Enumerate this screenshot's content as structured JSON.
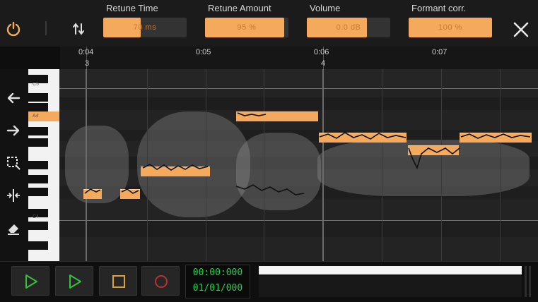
{
  "toolbar": {
    "power_icon": "power-icon",
    "sort_icon": "up-down-arrows-icon",
    "close_icon": "close-icon",
    "params": [
      {
        "label": "Retune Time",
        "value": "70 ms",
        "fill": 0.45
      },
      {
        "label": "Retune Amount",
        "value": "95 %",
        "fill": 0.95
      },
      {
        "label": "Volume",
        "value": "0.0 dB",
        "fill": 0.72
      },
      {
        "label": "Formant corr.",
        "value": "100 %",
        "fill": 1.0
      }
    ]
  },
  "ruler": {
    "times": [
      "0:04",
      "0:05",
      "0:06",
      "0:07"
    ],
    "bars": [
      "3",
      "4"
    ]
  },
  "tools": [
    {
      "name": "undo-arrow-icon"
    },
    {
      "name": "redo-arrow-icon"
    },
    {
      "name": "select-box-icon"
    },
    {
      "name": "split-icon"
    },
    {
      "name": "eraser-icon"
    }
  ],
  "piano": {
    "labels": [
      "C5",
      "A4",
      "C4"
    ]
  },
  "transport": {
    "time": "00:00:000",
    "position": "01/01/000",
    "colors": {
      "play": "#35c23a",
      "stop": "#d8a23c",
      "record": "#b8322f",
      "lcd": "#24d24a"
    },
    "progress_fill": 1.0
  },
  "colors": {
    "accent": "#f4a95c",
    "background": "#232323"
  }
}
